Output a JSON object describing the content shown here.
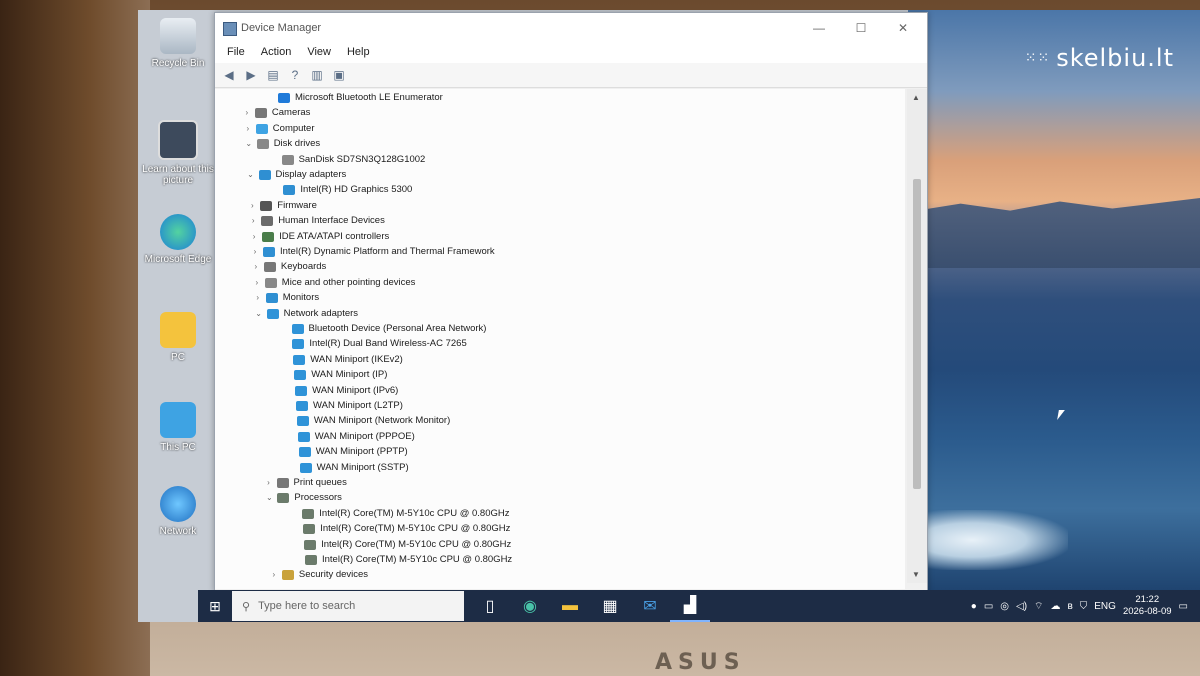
{
  "watermark": "skelbiu.lt",
  "desktop_icons": [
    {
      "label": "Recycle Bin",
      "icon": "recycle-bin-icon"
    },
    {
      "label": "Learn about this picture",
      "icon": "camera-icon"
    },
    {
      "label": "Microsoft Edge",
      "icon": "edge-icon"
    },
    {
      "label": "PC",
      "icon": "folder-user-icon"
    },
    {
      "label": "This PC",
      "icon": "computer-icon"
    },
    {
      "label": "Network",
      "icon": "network-icon"
    }
  ],
  "window": {
    "title": "Device Manager",
    "controls": {
      "minimize": "—",
      "maximize": "☐",
      "close": "✕"
    },
    "menu": [
      "File",
      "Action",
      "View",
      "Help"
    ]
  },
  "tree": [
    {
      "label": "Microsoft Bluetooth LE Enumerator",
      "level": 2,
      "icon": "bluetooth-icon",
      "expander": ""
    },
    {
      "label": "Cameras",
      "level": 1,
      "icon": "camera-device-icon",
      "expander": "›"
    },
    {
      "label": "Computer",
      "level": 1,
      "icon": "computer-icon",
      "expander": "›"
    },
    {
      "label": "Disk drives",
      "level": 1,
      "icon": "disk-icon",
      "expander": "⌄"
    },
    {
      "label": "SanDisk SD7SN3Q128G1002",
      "level": 2,
      "icon": "disk-icon",
      "expander": ""
    },
    {
      "label": "Display adapters",
      "level": 1,
      "icon": "monitor-icon",
      "expander": "⌄"
    },
    {
      "label": "Intel(R) HD Graphics 5300",
      "level": 2,
      "icon": "monitor-icon",
      "expander": ""
    },
    {
      "label": "Firmware",
      "level": 1,
      "icon": "chip-icon",
      "expander": "›"
    },
    {
      "label": "Human Interface Devices",
      "level": 1,
      "icon": "hid-icon",
      "expander": "›"
    },
    {
      "label": "IDE ATA/ATAPI controllers",
      "level": 1,
      "icon": "controller-icon",
      "expander": "›"
    },
    {
      "label": "Intel(R) Dynamic Platform and Thermal Framework",
      "level": 1,
      "icon": "board-icon",
      "expander": "›"
    },
    {
      "label": "Keyboards",
      "level": 1,
      "icon": "keyboard-icon",
      "expander": "›"
    },
    {
      "label": "Mice and other pointing devices",
      "level": 1,
      "icon": "mouse-icon",
      "expander": "›"
    },
    {
      "label": "Monitors",
      "level": 1,
      "icon": "monitor-icon",
      "expander": "›"
    },
    {
      "label": "Network adapters",
      "level": 1,
      "icon": "network-adapter-icon",
      "expander": "⌄"
    },
    {
      "label": "Bluetooth Device (Personal Area Network)",
      "level": 2,
      "icon": "network-adapter-icon",
      "expander": ""
    },
    {
      "label": "Intel(R) Dual Band Wireless-AC 7265",
      "level": 2,
      "icon": "network-adapter-icon",
      "expander": ""
    },
    {
      "label": "WAN Miniport (IKEv2)",
      "level": 2,
      "icon": "network-adapter-icon",
      "expander": ""
    },
    {
      "label": "WAN Miniport (IP)",
      "level": 2,
      "icon": "network-adapter-icon",
      "expander": ""
    },
    {
      "label": "WAN Miniport (IPv6)",
      "level": 2,
      "icon": "network-adapter-icon",
      "expander": ""
    },
    {
      "label": "WAN Miniport (L2TP)",
      "level": 2,
      "icon": "network-adapter-icon",
      "expander": ""
    },
    {
      "label": "WAN Miniport (Network Monitor)",
      "level": 2,
      "icon": "network-adapter-icon",
      "expander": ""
    },
    {
      "label": "WAN Miniport (PPPOE)",
      "level": 2,
      "icon": "network-adapter-icon",
      "expander": ""
    },
    {
      "label": "WAN Miniport (PPTP)",
      "level": 2,
      "icon": "network-adapter-icon",
      "expander": ""
    },
    {
      "label": "WAN Miniport (SSTP)",
      "level": 2,
      "icon": "network-adapter-icon",
      "expander": ""
    },
    {
      "label": "Print queues",
      "level": 1,
      "icon": "printer-icon",
      "expander": "›"
    },
    {
      "label": "Processors",
      "level": 1,
      "icon": "processor-icon",
      "expander": "⌄"
    },
    {
      "label": "Intel(R) Core(TM) M-5Y10c CPU @ 0.80GHz",
      "level": 2,
      "icon": "processor-icon",
      "expander": ""
    },
    {
      "label": "Intel(R) Core(TM) M-5Y10c CPU @ 0.80GHz",
      "level": 2,
      "icon": "processor-icon",
      "expander": ""
    },
    {
      "label": "Intel(R) Core(TM) M-5Y10c CPU @ 0.80GHz",
      "level": 2,
      "icon": "processor-icon",
      "expander": ""
    },
    {
      "label": "Intel(R) Core(TM) M-5Y10c CPU @ 0.80GHz",
      "level": 2,
      "icon": "processor-icon",
      "expander": ""
    },
    {
      "label": "Security devices",
      "level": 1,
      "icon": "security-icon",
      "expander": "›"
    }
  ],
  "taskbar": {
    "search_placeholder": "Type here to search",
    "apps": [
      "task-view-icon",
      "edge-icon",
      "file-explorer-icon",
      "store-icon",
      "mail-icon",
      "device-manager-icon"
    ],
    "tray_lang": "ENG",
    "time": "21:22",
    "date": "2026-08-09"
  },
  "brand": "ASUS",
  "colors": {
    "taskbar": "#1d2c45",
    "accent": "#7fb4ff",
    "window_bg": "#fcfcfc"
  }
}
